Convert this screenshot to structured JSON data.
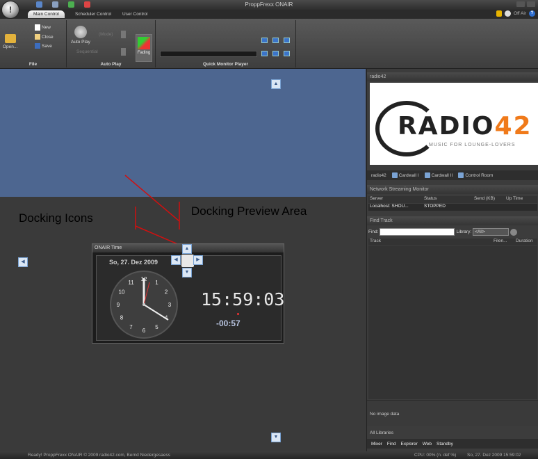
{
  "app": {
    "title": "ProppFrexx ONAIR"
  },
  "tabs": [
    "Main Control",
    "Scheduler Control",
    "User Control"
  ],
  "header_right": {
    "off_air_label": "Off Air"
  },
  "ribbon": {
    "file_group": {
      "label": "File",
      "open_label": "Open...",
      "new_label": "New",
      "close_label": "Close",
      "save_label": "Save"
    },
    "autoplay_group": {
      "label": "Auto Play",
      "autoplay_label": "Auto Play",
      "mode_label": "(Mode)",
      "sequential_label": "Sequential",
      "fading_label": "Fading"
    },
    "qmp_group": {
      "label": "Quick Monitor Player"
    }
  },
  "annotations": {
    "docking_icons": "Docking Icons",
    "docking_preview": "Docking Preview Area"
  },
  "clock": {
    "title": "ONAIR Time",
    "date": "So, 27. Dez 2009",
    "digital": "15:59:03",
    "countdown": "-00:57",
    "dial_numbers": [
      "12",
      "1",
      "2",
      "3",
      "4",
      "5",
      "6",
      "7",
      "8",
      "9",
      "10",
      "11"
    ]
  },
  "right_panel": {
    "header": "radio42",
    "logo": {
      "text": "RADIO42",
      "sub": "MUSIC FOR LOUNGE-LOVERS"
    },
    "tabs": [
      "radio42",
      "Cardwall I",
      "Cardwall II",
      "Control Room"
    ],
    "streaming": {
      "header": "Network Streaming Monitor",
      "columns": [
        "Server",
        "Status",
        "Send (KB)",
        "Up Time"
      ],
      "rows": [
        {
          "server": "Localhost: SHOU...",
          "status": "STOPPED",
          "send": "",
          "uptime": ""
        }
      ]
    },
    "find": {
      "header": "Find Track",
      "find_label": "Find:",
      "library_label": "Library:",
      "library_value": "<All>",
      "columns": [
        "Track",
        "Filen...",
        "Duration"
      ]
    },
    "no_image": "No image data",
    "all_libraries": "All Libraries",
    "bottom_tabs": [
      "Mixer",
      "Find",
      "Explorer",
      "Web",
      "Standby"
    ]
  },
  "statusbar": {
    "ready_text": "Ready!  ProppFrexx ONAIR  © 2009 radio42.com, Bernd Niedergesaess",
    "cpu_text": "CPU: 00% (n. def %)",
    "datetime_text": "So, 27. Dez 2009 15:59:02"
  }
}
